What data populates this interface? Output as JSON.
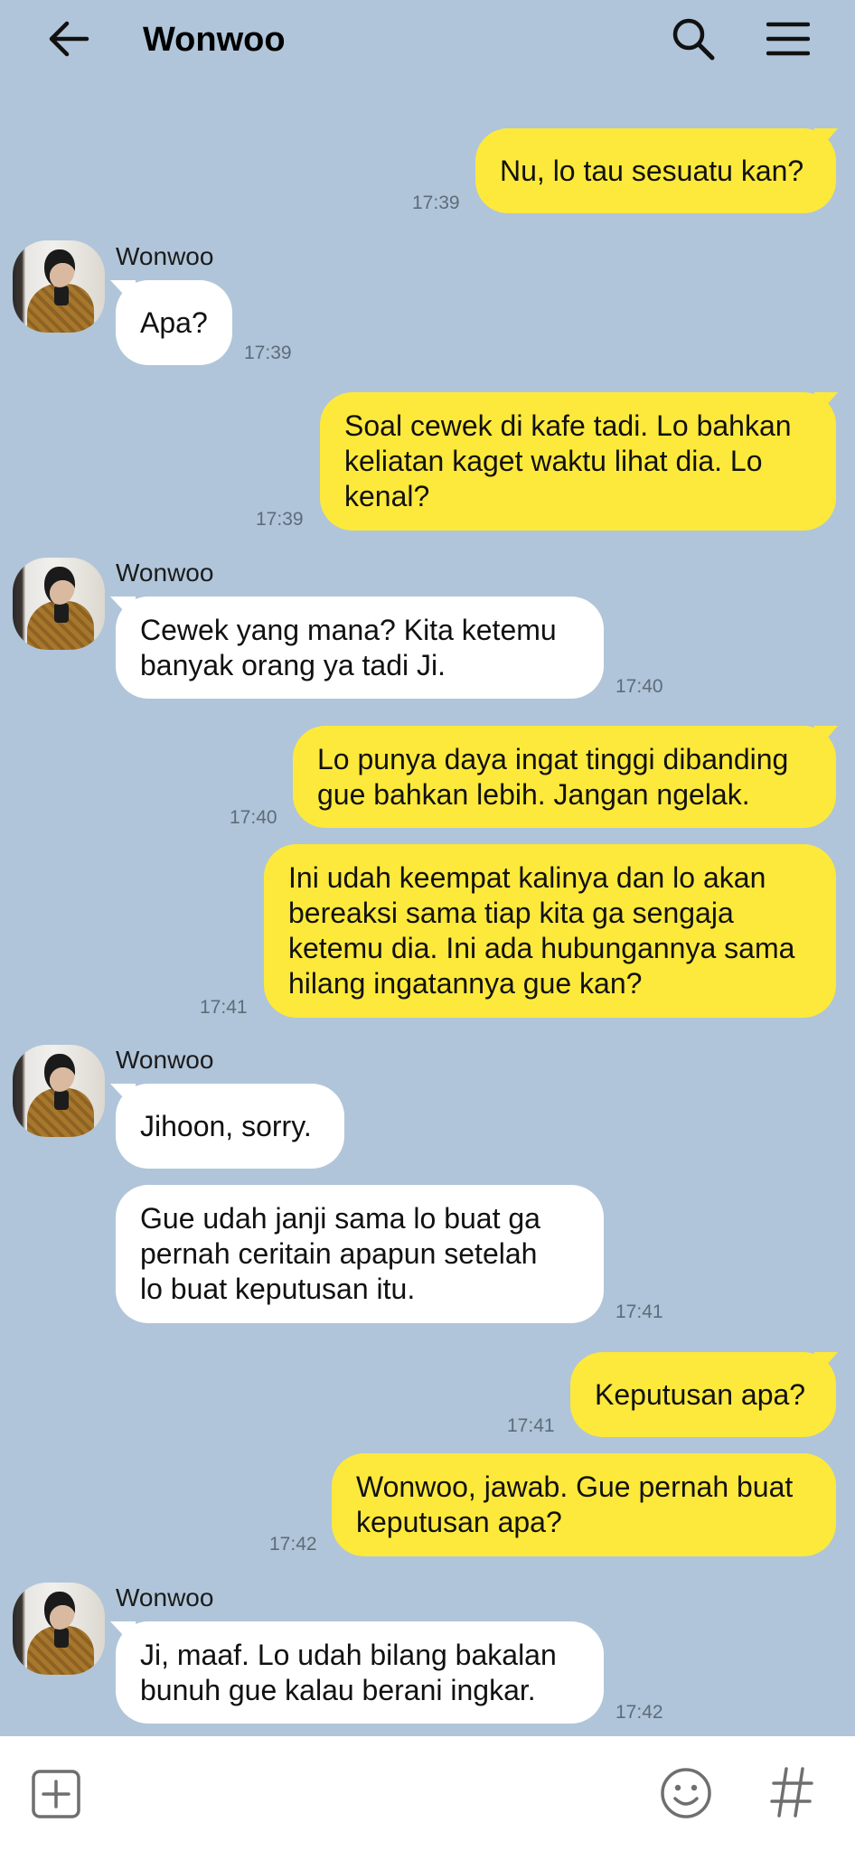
{
  "header": {
    "title": "Wonwoo",
    "back_icon": "arrow-left-icon",
    "search_icon": "search-icon",
    "menu_icon": "hamburger-menu-icon"
  },
  "colors": {
    "background": "#b0c5d9",
    "outgoing_bubble": "#fde93b",
    "incoming_bubble": "#ffffff",
    "timestamp": "#5e6c7a"
  },
  "messages": [
    {
      "direction": "out",
      "text": "Nu, lo tau sesuatu kan?",
      "time": "17:39"
    },
    {
      "direction": "in",
      "sender": "Wonwoo",
      "text": "Apa?",
      "time": "17:39"
    },
    {
      "direction": "out",
      "text": "Soal cewek di kafe tadi. Lo bahkan\nkeliatan kaget waktu lihat dia. Lo\nkenal?",
      "time": "17:39"
    },
    {
      "direction": "in",
      "sender": "Wonwoo",
      "text": "Cewek yang mana? Kita ketemu\nbanyak orang ya tadi Ji.",
      "time": "17:40"
    },
    {
      "direction": "out",
      "text": "Lo punya daya ingat tinggi dibanding\ngue bahkan lebih. Jangan ngelak.",
      "time": "17:40"
    },
    {
      "direction": "out",
      "text": "Ini udah keempat kalinya dan lo akan\nbereaksi sama tiap kita ga sengaja\nketemu dia. Ini ada hubungannya sama\nhilang ingatannya gue kan?",
      "time": "17:41"
    },
    {
      "direction": "in",
      "sender": "Wonwoo",
      "text": "Jihoon, sorry."
    },
    {
      "direction": "in",
      "text": "Gue udah janji sama lo buat ga\npernah ceritain apapun setelah\nlo buat keputusan itu.",
      "time": "17:41"
    },
    {
      "direction": "out",
      "text": "Keputusan apa?",
      "time": "17:41"
    },
    {
      "direction": "out",
      "text": "Wonwoo, jawab. Gue pernah buat\nkeputusan apa?",
      "time": "17:42"
    },
    {
      "direction": "in",
      "sender": "Wonwoo",
      "text": "Ji, maaf. Lo udah bilang bakalan\nbunuh gue kalau berani ingkar.",
      "time": "17:42"
    }
  ],
  "input_bar": {
    "add_icon": "plus-square-icon",
    "emoji_icon": "emoji-smile-icon",
    "hashtag_icon": "hashtag-icon"
  }
}
